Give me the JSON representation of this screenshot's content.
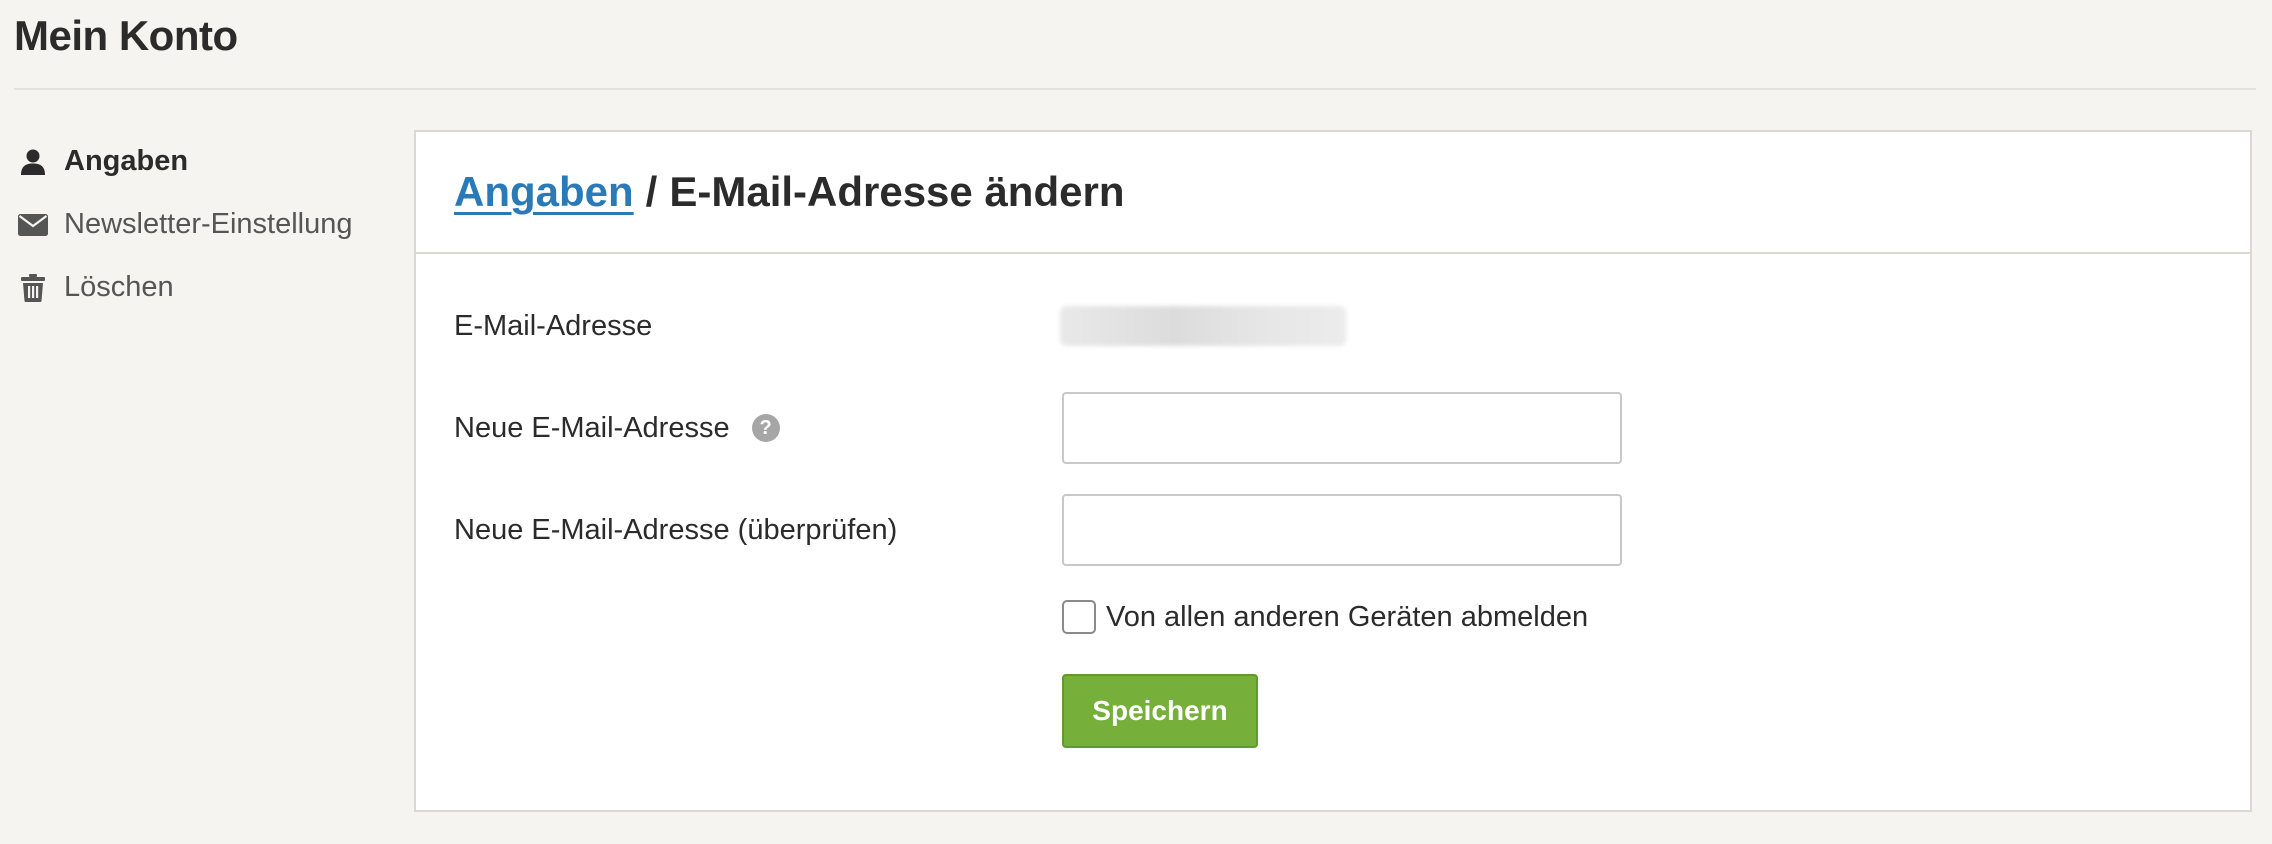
{
  "page": {
    "title": "Mein Konto"
  },
  "sidebar": {
    "items": [
      {
        "label": "Angaben",
        "icon": "user-icon",
        "active": true
      },
      {
        "label": "Newsletter-Einstellung",
        "icon": "envelope-icon",
        "active": false
      },
      {
        "label": "Löschen",
        "icon": "trash-icon",
        "active": false
      }
    ]
  },
  "card": {
    "breadcrumb_link": "Angaben",
    "breadcrumb_separator": "/",
    "breadcrumb_current": "E-Mail-Adresse ändern"
  },
  "form": {
    "current_email_label": "E-Mail-Adresse",
    "current_email_value": "",
    "new_email_label": "Neue E-Mail-Adresse",
    "new_email_value": "",
    "confirm_email_label": "Neue E-Mail-Adresse (überprüfen)",
    "confirm_email_value": "",
    "logout_checkbox_label": "Von allen anderen Geräten abmelden",
    "logout_checkbox_checked": false,
    "save_label": "Speichern",
    "help_glyph": "?"
  },
  "colors": {
    "background": "#f5f4f0",
    "link": "#2a7ab8",
    "save_button": "#76b03a",
    "card": "#ffffff"
  }
}
